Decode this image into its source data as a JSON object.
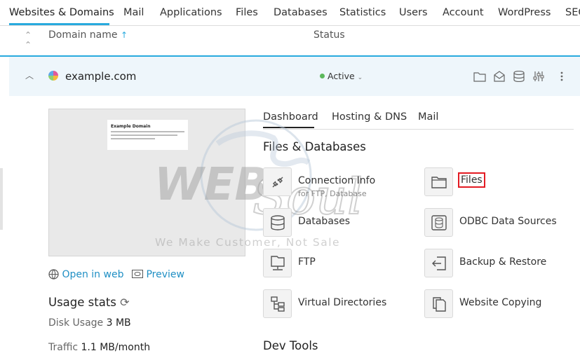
{
  "top_tabs": [
    "Websites & Domains",
    "Mail",
    "Applications",
    "Files",
    "Databases",
    "Statistics",
    "Users",
    "Account",
    "WordPress",
    "SEO"
  ],
  "list_header": {
    "domain_col": "Domain name",
    "sort_arrow": "↑",
    "status_col": "Status"
  },
  "domain_row": {
    "name": "example.com",
    "status": "Active",
    "actions": [
      "folder-icon",
      "mail-icon",
      "database-icon",
      "sliders-icon",
      "more-icon"
    ]
  },
  "preview": {
    "card_title": "Example Domain"
  },
  "links": {
    "open_in_web": "Open in web",
    "preview": "Preview"
  },
  "usage": {
    "title": "Usage stats",
    "disk_label": "Disk Usage",
    "disk_value": "3 MB",
    "traffic_label": "Traffic",
    "traffic_value": "1.1 MB/month"
  },
  "tabs": [
    "Dashboard",
    "Hosting & DNS",
    "Mail"
  ],
  "sections": {
    "files_db": "Files & Databases",
    "dev_tools": "Dev Tools"
  },
  "tools": {
    "connection_info": {
      "label": "Connection Info",
      "sub": "for FTP, Database",
      "icon": "plug-icon"
    },
    "files": {
      "label": "Files",
      "icon": "folder-icon"
    },
    "databases": {
      "label": "Databases",
      "icon": "database-icon"
    },
    "odbc": {
      "label": "ODBC Data Sources",
      "icon": "odbc-icon"
    },
    "ftp": {
      "label": "FTP",
      "icon": "ftp-icon"
    },
    "backup": {
      "label": "Backup & Restore",
      "icon": "backup-icon"
    },
    "virtual_dirs": {
      "label": "Virtual Directories",
      "icon": "sitemap-icon"
    },
    "website_copying": {
      "label": "Website Copying",
      "icon": "copy-icon"
    }
  },
  "watermark": {
    "brand": "WEB",
    "script": "Souls",
    "tagline": "We Make Customer, Not Sale"
  },
  "colors": {
    "accent": "#28aade",
    "link": "#1f8fc4",
    "active": "#5cb85c",
    "highlight": "#e31b23"
  }
}
